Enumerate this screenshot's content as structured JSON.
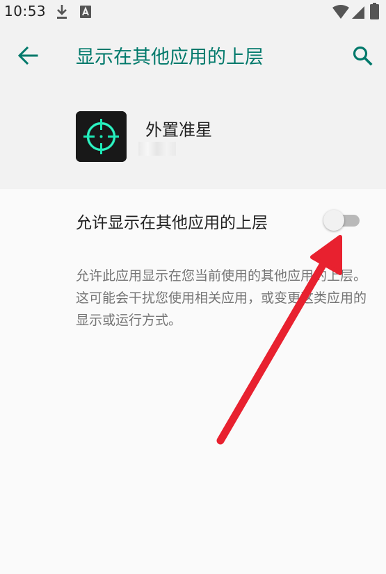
{
  "status_bar": {
    "time": "10:53",
    "icons": [
      "download-icon",
      "a-notification-icon",
      "wifi-icon",
      "signal-icon",
      "battery-icon"
    ]
  },
  "app_bar": {
    "title": "显示在其他应用的上层",
    "back_icon": "arrow-back-icon",
    "search_icon": "search-icon"
  },
  "app_info": {
    "name": "外置准星",
    "icon": "crosshair-icon"
  },
  "setting": {
    "label": "允许显示在其他应用的上层",
    "enabled": false,
    "description": "允许此应用显示在您当前使用的其他应用的上层。这可能会干扰您使用相关应用，或变更这类应用的显示或运行方式。"
  },
  "colors": {
    "accent": "#00796b",
    "annotation": "#e8212f"
  }
}
